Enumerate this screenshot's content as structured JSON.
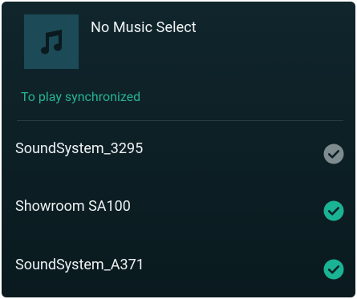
{
  "now_playing": {
    "title": "No Music Select",
    "art_icon": "music-note-icon"
  },
  "section": {
    "label": "To play synchronized"
  },
  "devices": [
    {
      "name": "SoundSystem_3295",
      "selected": false,
      "check_color": "#7e8b8f"
    },
    {
      "name": "Showroom SA100",
      "selected": true,
      "check_color": "#1ab394"
    },
    {
      "name": "SoundSystem_A371",
      "selected": true,
      "check_color": "#1ab394"
    }
  ],
  "colors": {
    "accent": "#27b394",
    "background": "#0d2026",
    "art_background": "#1c4a56"
  }
}
